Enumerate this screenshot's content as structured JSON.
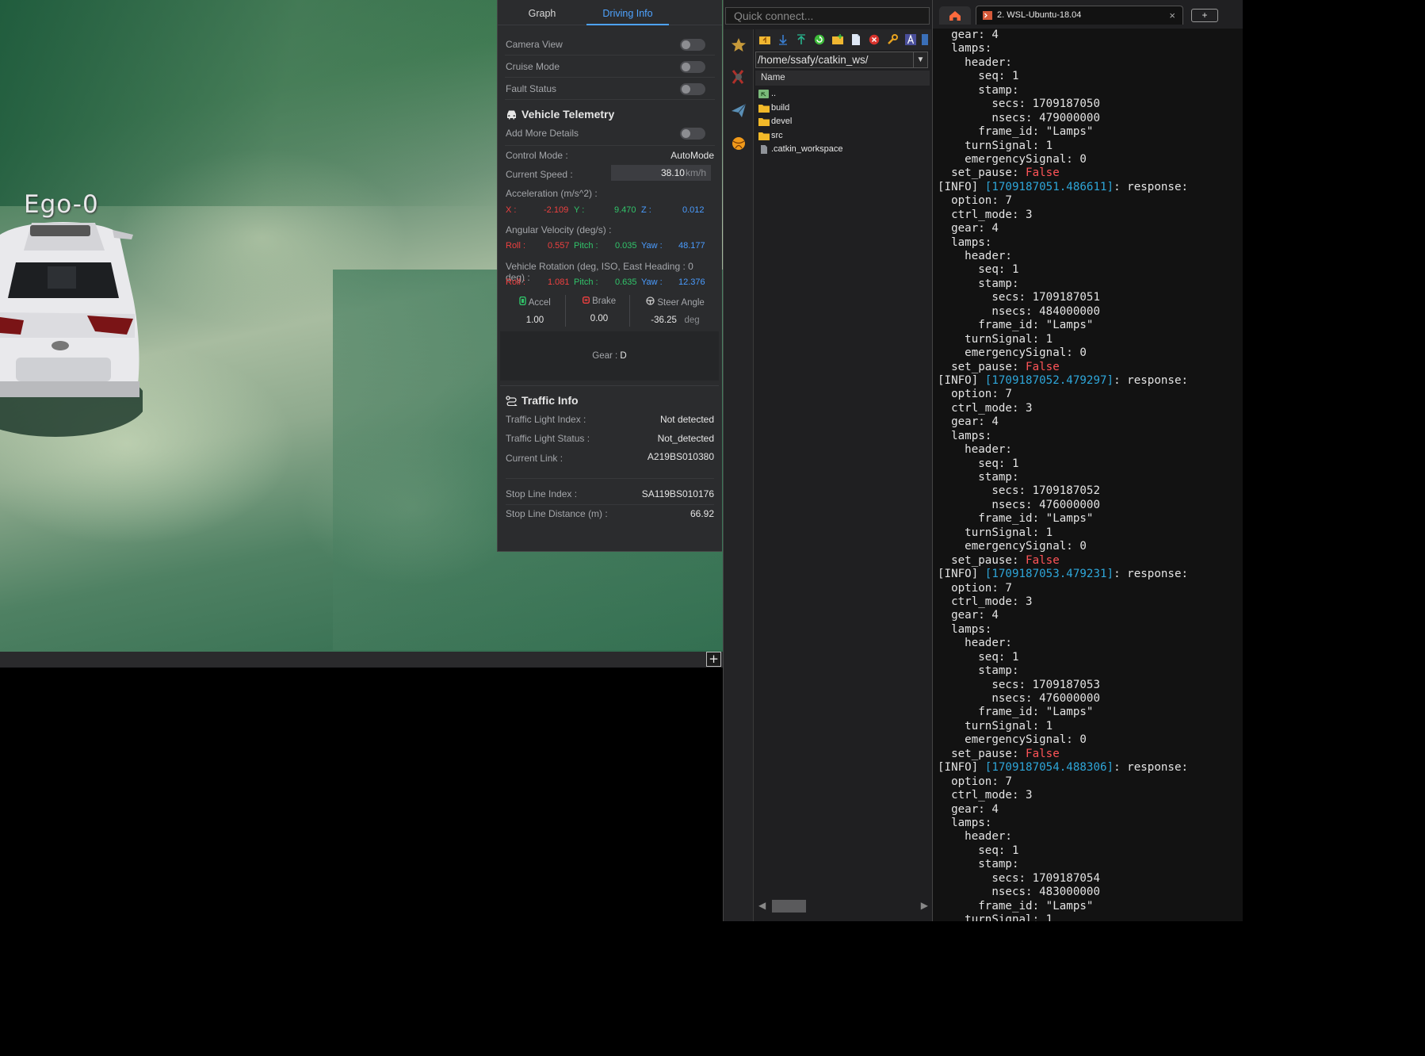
{
  "simulator": {
    "vehicle_label": "Ego-0",
    "add_button": "+"
  },
  "panel": {
    "tabs": [
      {
        "label": "Graph",
        "active": false
      },
      {
        "label": "Driving Info",
        "active": true
      }
    ],
    "toggles": [
      {
        "label": "Camera View",
        "on": false
      },
      {
        "label": "Cruise Mode",
        "on": false
      },
      {
        "label": "Fault Status",
        "on": false
      }
    ],
    "telemetry": {
      "title": "Vehicle Telemetry",
      "add_more_details": "Add More Details",
      "control_mode_label": "Control Mode :",
      "control_mode": "AutoMode",
      "current_speed_label": "Current Speed :",
      "current_speed": "38.10",
      "speed_unit": "km/h",
      "accel_label": "Acceleration (m/s^2) :",
      "accel": {
        "x_label": "X :",
        "x": "-2.109",
        "y_label": "Y :",
        "y": "9.470",
        "z_label": "Z :",
        "z": "0.012"
      },
      "angvel_label": "Angular Velocity (deg/s) :",
      "angvel": {
        "roll_label": "Roll :",
        "roll": "0.557",
        "pitch_label": "Pitch :",
        "pitch": "0.035",
        "yaw_label": "Yaw :",
        "yaw": "48.177"
      },
      "rotation_label": "Vehicle Rotation (deg, ISO, East Heading : 0 deg) :",
      "rotation": {
        "roll_label": "Roll :",
        "roll": "1.081",
        "pitch_label": "Pitch :",
        "pitch": "0.635",
        "yaw_label": "Yaw :",
        "yaw": "12.376"
      },
      "pedals": [
        {
          "label": "Accel",
          "value": "1.00",
          "unit": ""
        },
        {
          "label": "Brake",
          "value": "0.00",
          "unit": ""
        },
        {
          "label": "Steer Angle",
          "value": "-36.25",
          "unit": "deg"
        }
      ],
      "gear_label": "Gear :",
      "gear": "D"
    },
    "traffic": {
      "title": "Traffic Info",
      "rows": [
        {
          "label": "Traffic Light Index :",
          "value": "Not detected"
        },
        {
          "label": "Traffic Light Status :",
          "value": "Not_detected"
        },
        {
          "label": "Current Link :",
          "value": "A219BS010380"
        },
        {
          "label": "Stop Line Index :",
          "value": "SA119BS010176"
        },
        {
          "label": "Stop Line Distance (m) :",
          "value": "66.92"
        }
      ]
    }
  },
  "ftp": {
    "quick_connect_placeholder": "Quick connect...",
    "path": "/home/ssafy/catkin_ws/",
    "column_name": "Name",
    "files": [
      {
        "name": "..",
        "type": "parent"
      },
      {
        "name": "build",
        "type": "folder"
      },
      {
        "name": "devel",
        "type": "folder"
      },
      {
        "name": "src",
        "type": "folder"
      },
      {
        "name": ".catkin_workspace",
        "type": "file"
      }
    ]
  },
  "terminal": {
    "tab_title": "2. WSL-Ubuntu-18.04",
    "close": "×",
    "new_tab": "+",
    "colors": {
      "false": "#ff5458",
      "timestamp": "#2ea6d9"
    },
    "lines": [
      {
        "t": "  gear: 4"
      },
      {
        "t": "  lamps:"
      },
      {
        "t": "    header:"
      },
      {
        "t": "      seq: 1"
      },
      {
        "t": "      stamp:"
      },
      {
        "t": "        secs: 1709187050"
      },
      {
        "t": "        nsecs: 479000000"
      },
      {
        "t": "      frame_id: \"Lamps\""
      },
      {
        "t": "    turnSignal: 1"
      },
      {
        "t": "    emergencySignal: 0"
      },
      {
        "t": "  set_pause: ",
        "f": "False"
      },
      {
        "t": "[INFO] ",
        "c": "[1709187051.486611]",
        "r": ": response:"
      },
      {
        "t": "  option: 7"
      },
      {
        "t": "  ctrl_mode: 3"
      },
      {
        "t": "  gear: 4"
      },
      {
        "t": "  lamps:"
      },
      {
        "t": "    header:"
      },
      {
        "t": "      seq: 1"
      },
      {
        "t": "      stamp:"
      },
      {
        "t": "        secs: 1709187051"
      },
      {
        "t": "        nsecs: 484000000"
      },
      {
        "t": "      frame_id: \"Lamps\""
      },
      {
        "t": "    turnSignal: 1"
      },
      {
        "t": "    emergencySignal: 0"
      },
      {
        "t": "  set_pause: ",
        "f": "False"
      },
      {
        "t": "[INFO] ",
        "c": "[1709187052.479297]",
        "r": ": response:"
      },
      {
        "t": "  option: 7"
      },
      {
        "t": "  ctrl_mode: 3"
      },
      {
        "t": "  gear: 4"
      },
      {
        "t": "  lamps:"
      },
      {
        "t": "    header:"
      },
      {
        "t": "      seq: 1"
      },
      {
        "t": "      stamp:"
      },
      {
        "t": "        secs: 1709187052"
      },
      {
        "t": "        nsecs: 476000000"
      },
      {
        "t": "      frame_id: \"Lamps\""
      },
      {
        "t": "    turnSignal: 1"
      },
      {
        "t": "    emergencySignal: 0"
      },
      {
        "t": "  set_pause: ",
        "f": "False"
      },
      {
        "t": "[INFO] ",
        "c": "[1709187053.479231]",
        "r": ": response:"
      },
      {
        "t": "  option: 7"
      },
      {
        "t": "  ctrl_mode: 3"
      },
      {
        "t": "  gear: 4"
      },
      {
        "t": "  lamps:"
      },
      {
        "t": "    header:"
      },
      {
        "t": "      seq: 1"
      },
      {
        "t": "      stamp:"
      },
      {
        "t": "        secs: 1709187053"
      },
      {
        "t": "        nsecs: 476000000"
      },
      {
        "t": "      frame_id: \"Lamps\""
      },
      {
        "t": "    turnSignal: 1"
      },
      {
        "t": "    emergencySignal: 0"
      },
      {
        "t": "  set_pause: ",
        "f": "False"
      },
      {
        "t": "[INFO] ",
        "c": "[1709187054.488306]",
        "r": ": response:"
      },
      {
        "t": "  option: 7"
      },
      {
        "t": "  ctrl_mode: 3"
      },
      {
        "t": "  gear: 4"
      },
      {
        "t": "  lamps:"
      },
      {
        "t": "    header:"
      },
      {
        "t": "      seq: 1"
      },
      {
        "t": "      stamp:"
      },
      {
        "t": "        secs: 1709187054"
      },
      {
        "t": "        nsecs: 483000000"
      },
      {
        "t": "      frame_id: \"Lamps\""
      },
      {
        "t": "    turnSignal: 1"
      }
    ]
  }
}
